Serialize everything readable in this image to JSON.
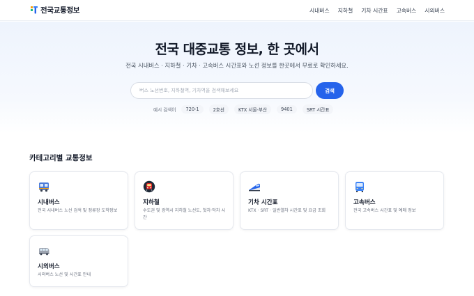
{
  "header": {
    "logo_text": "전국교통정보",
    "nav": [
      "시내버스",
      "지하철",
      "기차 시간표",
      "고속버스",
      "시외버스"
    ]
  },
  "hero": {
    "title": "전국 대중교통 정보, 한 곳에서",
    "subtitle": "전국 시내버스 · 지하철 · 기차 · 고속버스 시간표와 노선 정보를 한곳에서 무료로 확인하세요.",
    "search_placeholder": "버스 노선번호, 지하철역, 기차역을 검색해보세요",
    "search_button": "검색",
    "examples_label": "예시 검색어",
    "examples": [
      "720-1",
      "2호선",
      "KTX 서울-부산",
      "9401",
      "SRT 시간표"
    ]
  },
  "categories": {
    "title": "카테고리별 교통정보",
    "items": [
      {
        "icon": "city-bus-icon",
        "title": "시내버스",
        "desc": "전국 시내버스 노선 검색 및 정류장 도착정보"
      },
      {
        "icon": "subway-icon",
        "title": "지하철",
        "desc": "수도권 및 광역시 지하철 노선도, 첫차·막차 시간"
      },
      {
        "icon": "train-icon",
        "title": "기차 시간표",
        "desc": "KTX · SRT · 일반열차 시간표 및 요금 조회"
      },
      {
        "icon": "express-bus-icon",
        "title": "고속버스",
        "desc": "전국 고속버스 시간표 및 예매 정보"
      },
      {
        "icon": "intercity-bus-icon",
        "title": "시외버스",
        "desc": "시외버스 노선 및 시간표 안내"
      }
    ]
  },
  "colors": {
    "accent": "#2563eb",
    "hero_bg": "#eef4fd",
    "text": "#111827"
  }
}
